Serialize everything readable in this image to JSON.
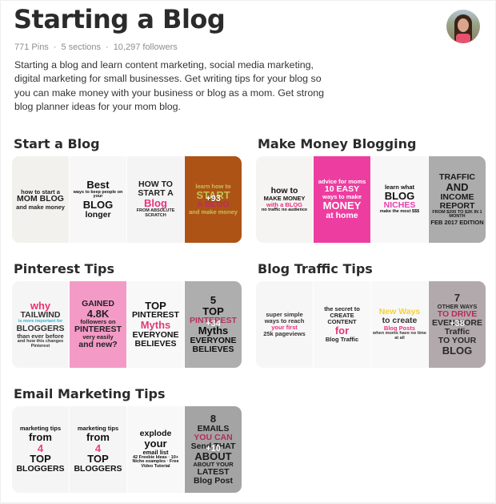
{
  "board": {
    "title": "Starting a Blog",
    "pins": "771 Pins",
    "sections_count": "5 sections",
    "followers": "10,297 followers",
    "separator": "·",
    "description": "Starting a blog and learn content marketing, social media marketing, digital marketing for small businesses. Get writing tips for your blog so you can make money with your business or blog as a mom. Get strong blog planner ideas for your mom blog."
  },
  "avatar": {
    "icon": "user-avatar"
  },
  "sections": [
    {
      "title": "Start a Blog",
      "more_count": "+93",
      "tiles": [
        {
          "lines": [
            "how to start a",
            "MOM BLOG",
            "and make money"
          ],
          "bg": "#f3f1ee",
          "fg": "#222"
        },
        {
          "lines": [
            "Best",
            "ways to keep people on your",
            "BLOG",
            "longer"
          ],
          "bg": "#f7f7f7",
          "fg": "#111"
        },
        {
          "lines": [
            "HOW TO",
            "START A",
            "Blog",
            "FROM ABSOLUTE SCRATCH"
          ],
          "bg": "#f4f4f4",
          "fg": "#222",
          "accent": "#e8327c"
        },
        {
          "lines": [
            "learn how to",
            "START",
            "A BLOG",
            "and make money"
          ],
          "bg": "#d4661a",
          "fg": "#f2e96a",
          "accent": "#e8327c"
        }
      ]
    },
    {
      "title": "Make Money Blogging",
      "more_count": "",
      "tiles": [
        {
          "lines": [
            "how to",
            "MAKE MONEY",
            "with a BLOG",
            "no traffic no audience"
          ],
          "bg": "#f6f4f2",
          "fg": "#111",
          "accent": "#e8327c"
        },
        {
          "lines": [
            "advice for moms",
            "10 EASY",
            "ways to make",
            "MONEY",
            "at home"
          ],
          "bg": "#ee3da0",
          "fg": "#fff"
        },
        {
          "lines": [
            "learn what",
            "BLOG",
            "NICHES",
            "make the most $$$"
          ],
          "bg": "#f7f7f7",
          "fg": "#111",
          "accent": "#e83fb0"
        },
        {
          "lines": [
            "TRAFFIC",
            "AND",
            "INCOME",
            "REPORT",
            "FROM $200 TO $2K IN 1 MONTH",
            "FEB 2017 EDITION"
          ],
          "bg": "#d2d2d2",
          "fg": "#222"
        }
      ]
    },
    {
      "title": "Pinterest Tips",
      "more_count": "+34",
      "tiles": [
        {
          "lines": [
            "why",
            "TAILWIND",
            "is more important for",
            "BLOGGERS",
            "than ever before",
            "and how this changes Pinterest"
          ],
          "bg": "#f5f5f5",
          "fg": "#333",
          "accent": "#2bb3d6",
          "accent2": "#ef2f6e"
        },
        {
          "lines": [
            "GAINED",
            "4.8K",
            "followers on",
            "PINTEREST",
            "very easily",
            "and new?"
          ],
          "bg": "#f39ac6",
          "fg": "#222"
        },
        {
          "lines": [
            "TOP",
            "PINTEREST",
            "Myths",
            "EVERYONE",
            "BELIEVES"
          ],
          "bg": "#f8f8f8",
          "fg": "#111",
          "accent": "#e03a78"
        },
        {
          "lines": [
            "5",
            "TOP",
            "PINTEREST",
            "Myths",
            "EVERYONE",
            "BELIEVES"
          ],
          "bg": "#d5d5d5",
          "fg": "#111",
          "accent": "#e03a78"
        }
      ]
    },
    {
      "title": "Blog Traffic Tips",
      "more_count": "+38",
      "tiles": [
        {
          "lines": [
            "super simple",
            "ways to reach",
            "your first",
            "25k pageviews"
          ],
          "bg": "#f6f6f6",
          "fg": "#333",
          "accent": "#e8327c"
        },
        {
          "lines": [
            "the secret to",
            "CREATE CONTENT",
            "for",
            "Blog Traffic"
          ],
          "bg": "#f8f8f8",
          "fg": "#222",
          "accent": "#e8327c"
        },
        {
          "lines": [
            "New Ways",
            "to create",
            "Blog Posts",
            "when moms have no time at all"
          ],
          "bg": "#f8f8f8",
          "fg": "#333",
          "accent": "#e8327c",
          "accent2": "#f2d33a"
        },
        {
          "lines": [
            "7",
            "OTHER WAYS",
            "TO DRIVE",
            "EVEN MORE",
            "Traffic",
            "TO YOUR",
            "BLOG"
          ],
          "bg": "#d9cfd2",
          "fg": "#333",
          "accent": "#e0346f"
        }
      ]
    },
    {
      "title": "Email Marketing Tips",
      "more_count": "+10",
      "tiles": [
        {
          "lines": [
            "marketing tips",
            "from",
            "4",
            "TOP",
            "BLOGGERS"
          ],
          "bg": "#f5f5f5",
          "fg": "#111",
          "accent": "#ef3c84"
        },
        {
          "lines": [
            "marketing tips",
            "from",
            "4",
            "TOP",
            "BLOGGERS"
          ],
          "bg": "#f5f5f5",
          "fg": "#111",
          "accent": "#ef3c84"
        },
        {
          "lines": [
            "explode",
            "your",
            "email list",
            "42 Freebie Ideas · 10+ Niche examples · Free Video Tutorial"
          ],
          "bg": "#f8f8f8",
          "fg": "#111"
        },
        {
          "lines": [
            "8",
            "EMAILS",
            "YOU CAN",
            "Send THAT",
            "ABOUT",
            "ABOUT YOUR",
            "LATEST",
            "Blog Post"
          ],
          "bg": "#c9c9c9",
          "fg": "#222",
          "accent": "#e0346f"
        }
      ]
    }
  ]
}
